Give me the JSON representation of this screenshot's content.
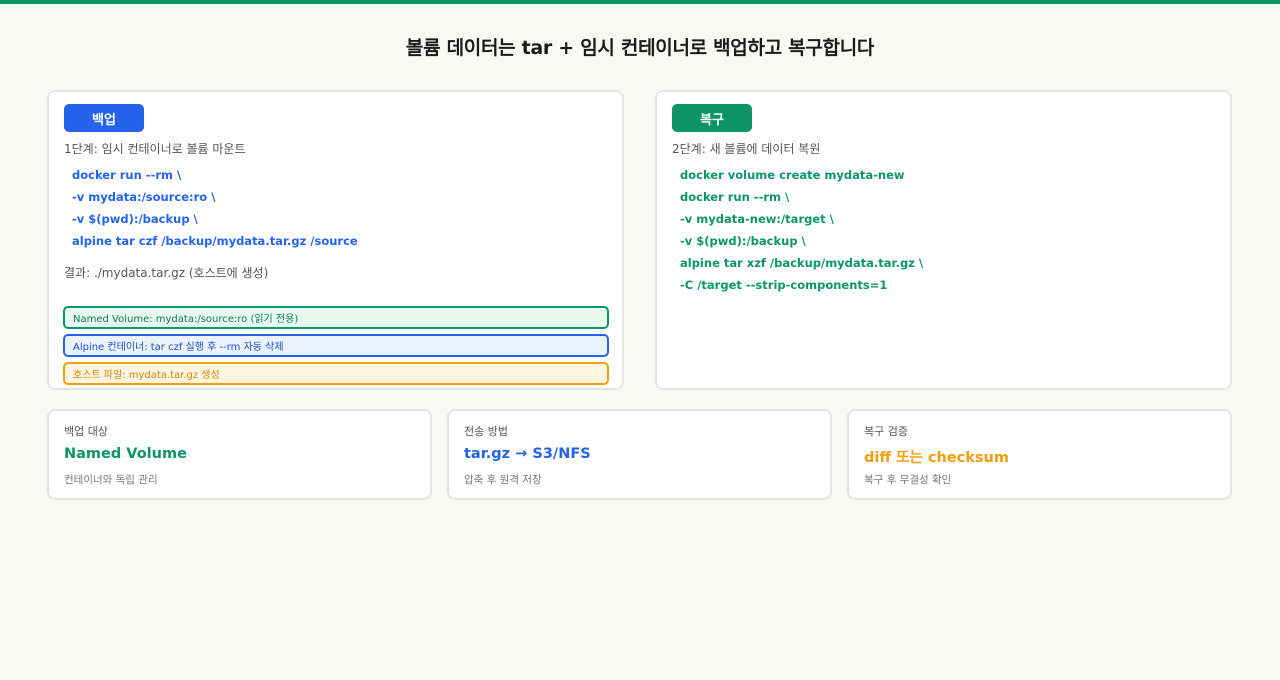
{
  "title": "볼륨 데이터는 tar + 임시 컨테이너로 백업하고 복구합니다",
  "backup": {
    "badge": "백업",
    "step": "1단계: 임시 컨테이너로 볼륨 마운트",
    "code": [
      "docker run --rm \\",
      "-v mydata:/source:ro \\",
      "-v $(pwd):/backup \\",
      "alpine tar czf /backup/mydata.tar.gz /source"
    ],
    "result": "결과: ./mydata.tar.gz (호스트에 생성)",
    "flow": [
      "Named Volume: mydata:/source:ro (읽기 전용)",
      "Alpine 컨테이너: tar czf 실행 후 --rm 자동 삭제",
      "호스트 파일: mydata.tar.gz 생성"
    ]
  },
  "restore": {
    "badge": "복구",
    "step": "2단계: 새 볼륨에 데이터 복원",
    "code": [
      "docker volume create mydata-new",
      "docker run --rm \\",
      "-v mydata-new:/target \\",
      "-v $(pwd):/backup \\",
      "alpine tar xzf /backup/mydata.tar.gz \\",
      "-C /target --strip-components=1"
    ]
  },
  "cards": [
    {
      "label": "백업 대상",
      "value": "Named Volume",
      "desc": "컨테이너와 독립 관리"
    },
    {
      "label": "전송 방법",
      "value": "tar.gz → S3/NFS",
      "desc": "압축 후 원격 저장"
    },
    {
      "label": "복구 검증",
      "value": "diff 또는 checksum",
      "desc": "복구 후 무결성 확인"
    }
  ],
  "colors": {
    "accent_green": "#0d9467",
    "accent_blue": "#2563eb",
    "accent_orange": "#f59e0b"
  }
}
